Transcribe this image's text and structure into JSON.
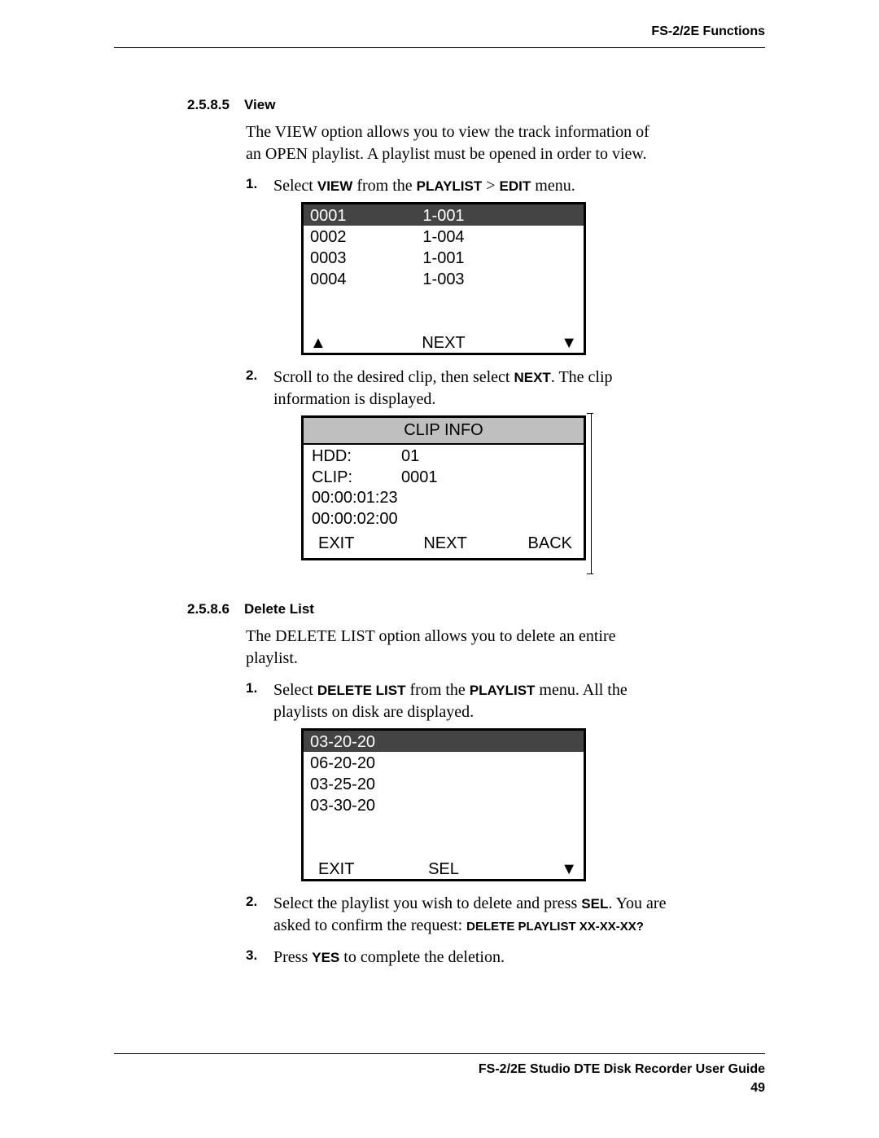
{
  "header": {
    "right": "FS-2/2E Functions"
  },
  "sections": {
    "view": {
      "num": "2.5.8.5",
      "title": "View",
      "intro": "The VIEW option allows you to view the track information of an OPEN playlist. A playlist must be opened in order to view.",
      "step1_pre": "Select ",
      "step1_b1": "VIEW",
      "step1_mid": " from the ",
      "step1_b2": "PLAYLIST",
      "step1_gt": " > ",
      "step1_b3": "EDIT",
      "step1_post": " menu.",
      "screen1": {
        "rows": [
          {
            "c1": "0001",
            "c2": "1-001",
            "hl": true
          },
          {
            "c1": "0002",
            "c2": "1-004"
          },
          {
            "c1": "0003",
            "c2": "1-001"
          },
          {
            "c1": "0004",
            "c2": "1-003"
          }
        ],
        "foot": {
          "left": "▲",
          "mid": "NEXT",
          "right": "▼"
        }
      },
      "step2_pre": "Scroll to the desired clip, then select ",
      "step2_b1": "NEXT",
      "step2_post": ". The clip information is displayed.",
      "screen2": {
        "title": "CLIP INFO",
        "lines": {
          "hdd_label": "HDD:",
          "hdd_val": "01",
          "clip_label": "CLIP:",
          "clip_val": "0001",
          "tc1": "00:00:01:23",
          "tc2": "00:00:02:00"
        },
        "foot": {
          "l": "EXIT",
          "m": "NEXT",
          "r": "BACK"
        }
      }
    },
    "delete": {
      "num": "2.5.8.6",
      "title": "Delete List",
      "intro": "The DELETE LIST option allows you to delete an entire playlist.",
      "step1_pre": "Select ",
      "step1_b1": "DELETE LIST",
      "step1_mid": " from the ",
      "step1_b2": "PLAYLIST",
      "step1_post": " menu. All the playlists on disk are displayed.",
      "screen3": {
        "rows": [
          {
            "c1": "03-20-20",
            "hl": true
          },
          {
            "c1": "06-20-20"
          },
          {
            "c1": "03-25-20"
          },
          {
            "c1": "03-30-20"
          }
        ],
        "foot": {
          "left": "EXIT",
          "mid": "SEL",
          "right": "▼"
        }
      },
      "step2_pre": "Select the playlist you wish to delete and press ",
      "step2_b1": "SEL",
      "step2_mid": ". You are asked to confirm the request: ",
      "step2_b2": "DELETE PLAYLIST XX-XX-XX?",
      "step3_pre": "Press ",
      "step3_b1": "YES",
      "step3_post": " to complete the deletion."
    }
  },
  "footer": {
    "title": "FS-2/2E Studio DTE Disk Recorder User Guide",
    "page": "49"
  }
}
